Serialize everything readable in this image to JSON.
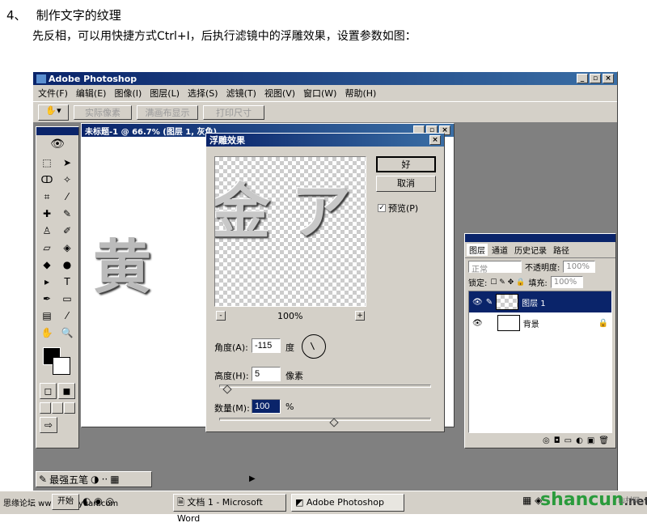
{
  "step": {
    "number": "4、",
    "title": "制作文字的纹理"
  },
  "description": "先反相，可以用快捷方式Ctrl+I，后执行滤镜中的浮雕效果，设置参数如图：",
  "app": {
    "title": "Adobe Photoshop",
    "menu": [
      "文件(F)",
      "编辑(E)",
      "图像(I)",
      "图层(L)",
      "选择(S)",
      "滤镜(T)",
      "视图(V)",
      "窗口(W)",
      "帮助(H)"
    ],
    "options": [
      "实际像素",
      "满画布显示",
      "打印尺寸"
    ]
  },
  "document": {
    "title": "未标题-1 @ 66.7% (图层 1, 灰色)",
    "text_left": "黄",
    "text_preview": "金 ア"
  },
  "dialog": {
    "title": "浮雕效果",
    "ok": "好",
    "cancel": "取消",
    "preview_label": "预览(P)",
    "zoom": "100%",
    "zoom_minus": "-",
    "zoom_plus": "+",
    "angle_label": "角度(A):",
    "angle_value": "-115",
    "angle_unit": "度",
    "height_label": "高度(H):",
    "height_value": "5",
    "height_unit": "像素",
    "amount_label": "数量(M):",
    "amount_value": "100",
    "amount_unit": "%"
  },
  "layers": {
    "tabs": [
      "图层",
      "通道",
      "历史记录",
      "路径"
    ],
    "mode": "正常",
    "opacity_label": "不透明度:",
    "opacity_value": "100%",
    "lock_label": "锁定:",
    "fill_label": "填充:",
    "fill_value": "100%",
    "items": [
      {
        "name": "图层 1"
      },
      {
        "name": "背景"
      }
    ]
  },
  "taskbar": {
    "ime": "最强五笔",
    "start": "开始",
    "tasks": [
      "文档 1 - Microsoft Word",
      "Adobe Photoshop"
    ]
  },
  "watermarks": {
    "left": "思缘论坛 www.missyuan.com",
    "right_brand": "shancun",
    "right_suffix": ".net",
    "right_small": "山村网"
  }
}
